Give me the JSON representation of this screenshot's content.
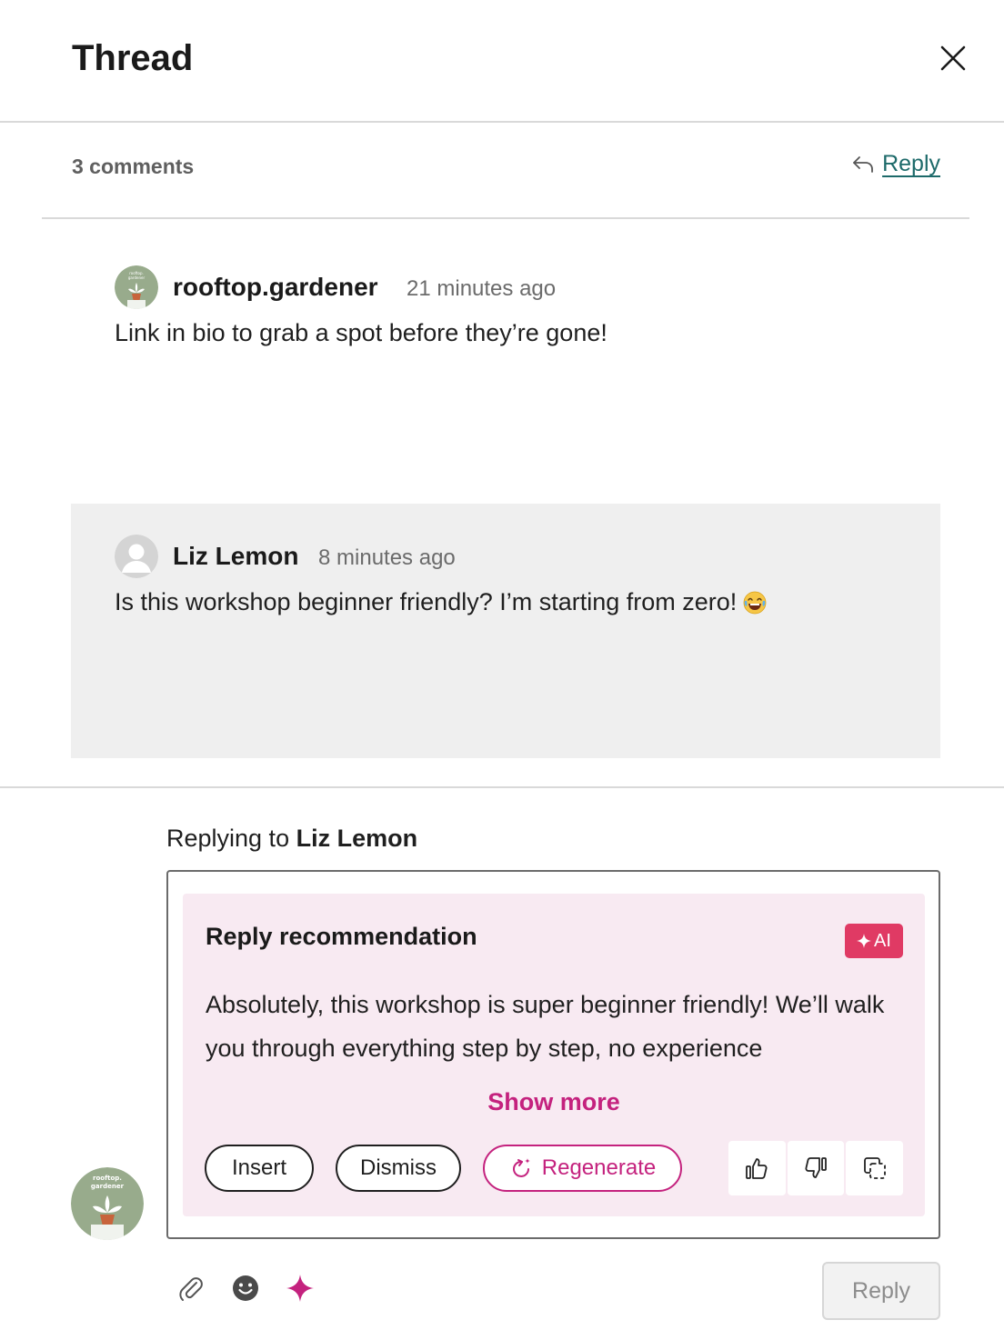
{
  "header": {
    "title": "Thread"
  },
  "thread": {
    "count_label": "3 comments",
    "reply_label": "Reply"
  },
  "comments": [
    {
      "author": "rooftop.gardener",
      "time": "21 minutes ago",
      "text": "Link in bio to grab a spot before they’re gone!",
      "avatar_text": "rooftop. gardener"
    },
    {
      "author": "Liz Lemon",
      "time": "8 minutes ago",
      "text": "Is this workshop beginner friendly? I’m starting from zero!",
      "emoji": "laughing-tears-emoji"
    }
  ],
  "compose": {
    "replying_prefix": "Replying to",
    "replying_name": "Liz Lemon",
    "avatar_text": "rooftop. gardener",
    "send_label": "Reply"
  },
  "recommendation": {
    "title": "Reply recommendation",
    "badge": "AI",
    "text": "Absolutely, this workshop is super beginner friendly! We’ll walk you through everything step by step, no experience",
    "show_more": "Show more",
    "insert_label": "Insert",
    "dismiss_label": "Dismiss",
    "regenerate_label": "Regenerate"
  },
  "colors": {
    "accent": "#c4227e",
    "ai_badge": "#e03a64",
    "link": "#1d6a6a",
    "card_bg": "#f8eaf2",
    "avatar_bg": "#98ab8c"
  },
  "icons": [
    "close-icon",
    "reply-arrow-icon",
    "thumbs-up-icon",
    "thumbs-down-icon",
    "copy-icon",
    "paperclip-icon",
    "smiley-icon",
    "sparkle-icon",
    "regenerate-icon"
  ]
}
